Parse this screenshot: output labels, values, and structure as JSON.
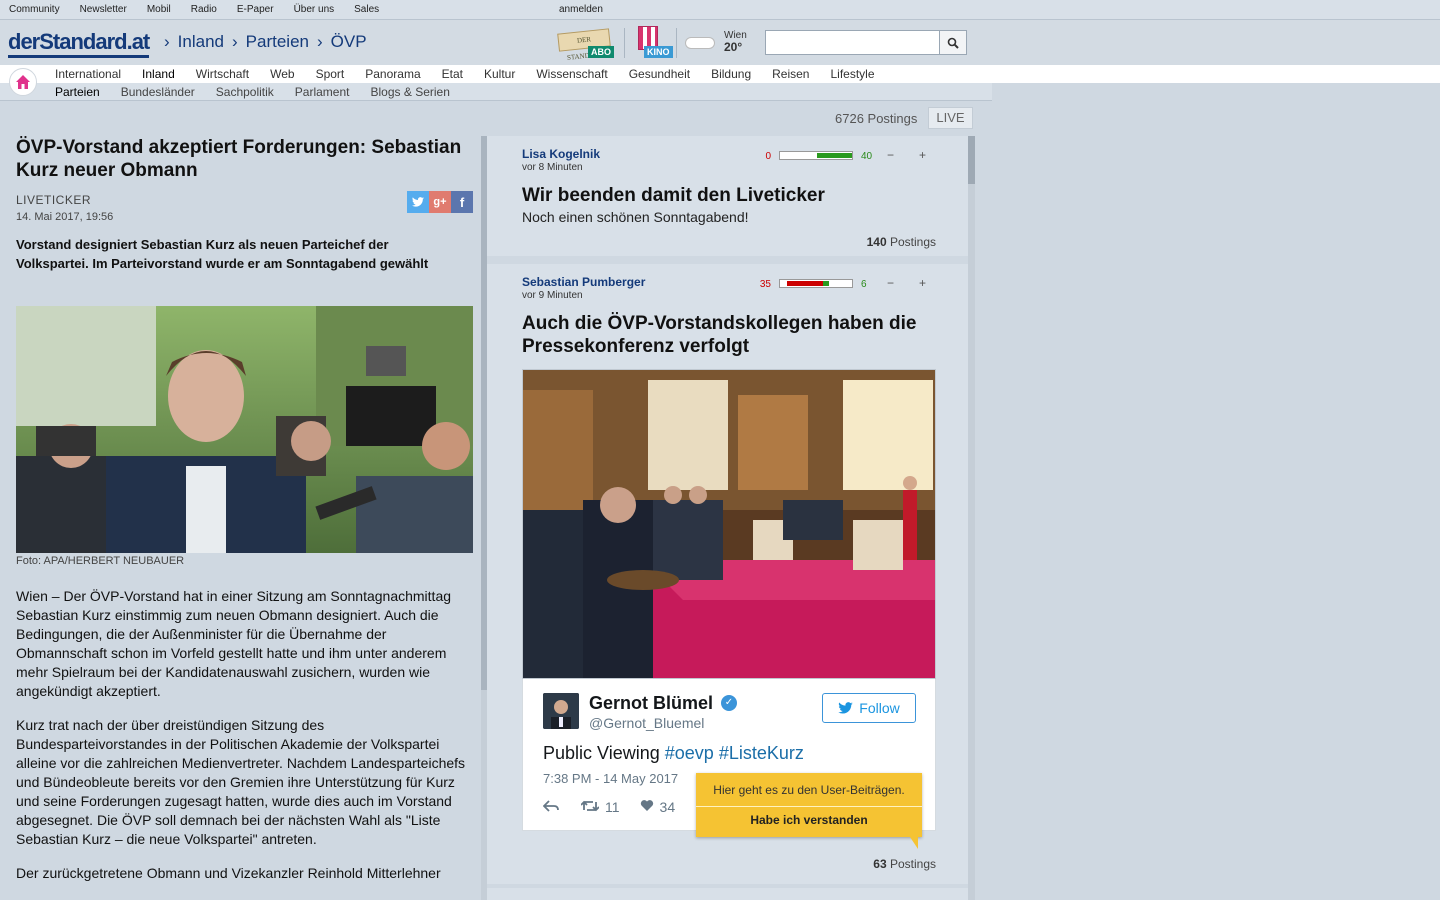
{
  "topbar": {
    "links": [
      "Community",
      "Newsletter",
      "Mobil",
      "Radio",
      "E-Paper",
      "Über uns",
      "Sales"
    ],
    "login": "anmelden"
  },
  "header": {
    "logo": "derStandard.at",
    "breadcrumb": [
      "Inland",
      "Parteien",
      "ÖVP"
    ],
    "abo_label": "ABO",
    "abo_paper": "DER STANDARD",
    "kino_label": "KINO",
    "weather_city": "Wien",
    "weather_temp": "20°",
    "search_placeholder": ""
  },
  "nav": {
    "main": [
      "International",
      "Inland",
      "Wirtschaft",
      "Web",
      "Sport",
      "Panorama",
      "Etat",
      "Kultur",
      "Wissenschaft",
      "Gesundheit",
      "Bildung",
      "Reisen",
      "Lifestyle"
    ],
    "main_active": "Inland",
    "sub": [
      "Parteien",
      "Bundesländer",
      "Sachpolitik",
      "Parlament",
      "Blogs & Serien"
    ],
    "sub_active": "Parteien"
  },
  "ticker_bar": {
    "postings": "6726 Postings",
    "live": "LIVE"
  },
  "article": {
    "title": "ÖVP-Vorstand akzeptiert Forderungen: Sebastian Kurz neuer Obmann",
    "kicker": "LIVETICKER",
    "date": "14. Mai 2017, 19:56",
    "lead": "Vorstand designiert Sebastian Kurz als neuen Parteichef der Volkspartei. Im Parteivorstand wurde er am Sonntagabend gewählt",
    "caption": "Foto: APA/HERBERT NEUBAUER",
    "paragraphs": [
      "Wien – Der ÖVP-Vorstand hat in einer Sitzung am Sonntagnachmittag Sebastian Kurz einstimmig zum neuen Obmann designiert. Auch die Bedingungen, die der Außenminister für die Übernahme der Obmannschaft schon im Vorfeld gestellt hatte und ihm unter anderem mehr Spielraum bei der Kandidatenauswahl zusichern, wurden wie angekündigt akzeptiert.",
      "Kurz trat nach der über dreistündigen Sitzung des Bundesparteivorstandes in der Politischen Akademie der Volkspartei alleine vor die zahlreichen Medienvertreter. Nachdem Landesparteichefs und Bündeobleute bereits vor den Gremien ihre Unterstützung für Kurz und seine Forderungen zugesagt hatten, wurde dies auch im Vorstand abgesegnet. Die ÖVP soll demnach bei der nächsten Wahl als \"Liste Sebastian Kurz – die neue Volkspartei\" antreten.",
      "Der zurückgetretene Obmann und Vizekanzler Reinhold Mitterlehner"
    ]
  },
  "entries": [
    {
      "author": "Lisa Kogelnik",
      "time": "vor 8 Minuten",
      "rating_neg": "0",
      "rating_pos": "40",
      "title": "Wir beenden damit den Liveticker",
      "subtitle": "Noch einen schönen Sonntagabend!",
      "postings_count": "140",
      "postings_label": "Postings"
    },
    {
      "author": "Sebastian Pumberger",
      "time": "vor 9 Minuten",
      "rating_neg": "35",
      "rating_pos": "6",
      "title": "Auch die ÖVP-Vorstandskollegen haben die Pressekonferenz verfolgt",
      "postings_count": "63",
      "postings_label": "Postings"
    }
  ],
  "tweet": {
    "name": "Gernot Blümel",
    "handle": "@Gernot_Bluemel",
    "follow": "Follow",
    "text": "Public Viewing",
    "hashtag1": "#oevp",
    "hashtag2": "#ListeKurz",
    "date": "7:38 PM - 14 May 2017",
    "retweets": "11",
    "likes": "34"
  },
  "tooltip": {
    "message": "Hier geht es zu den User-Beiträgen.",
    "confirm": "Habe ich verstanden"
  },
  "colors": {
    "brand_blue": "#143a7a",
    "tooltip_yellow": "#f5c333",
    "twitter_blue": "#1b95e0"
  }
}
